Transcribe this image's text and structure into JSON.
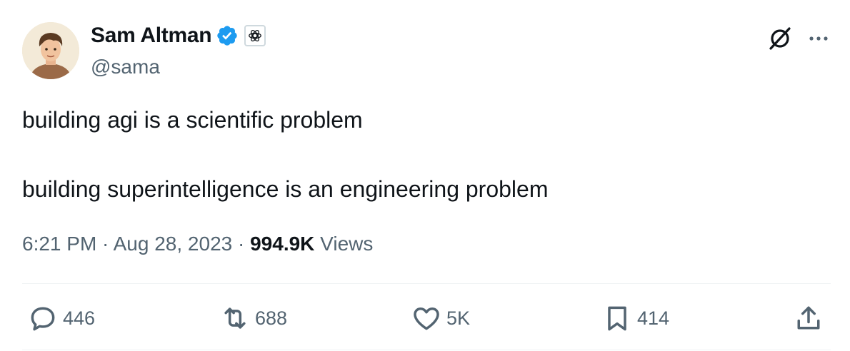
{
  "author": {
    "name": "Sam Altman",
    "handle": "@sama",
    "verified_color": "#1d9bf0"
  },
  "tweet": {
    "line1": "building agi is a scientific problem",
    "line2": "building superintelligence is an engineering problem"
  },
  "meta": {
    "time": "6:21 PM",
    "separator1": " · ",
    "date": "Aug 28, 2023",
    "separator2": " · ",
    "views_count": "994.9K",
    "views_label": " Views"
  },
  "actions": {
    "replies": "446",
    "retweets": "688",
    "likes": "5K",
    "bookmarks": "414"
  },
  "icons": {
    "reply": "reply-icon",
    "retweet": "retweet-icon",
    "like": "heart-icon",
    "bookmark": "bookmark-icon",
    "share": "share-icon",
    "grok": "grok-icon",
    "more": "more-icon",
    "verified": "verified-badge-icon",
    "affiliation": "openai-logo-icon"
  }
}
